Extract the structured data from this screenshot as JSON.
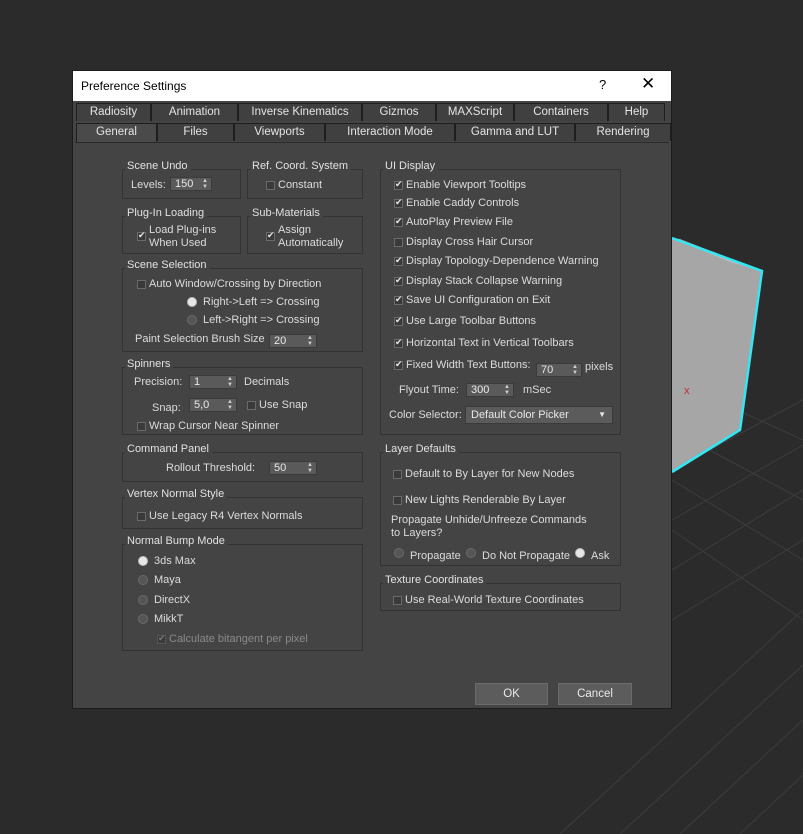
{
  "window": {
    "title": "Preference Settings",
    "help_label": "?",
    "close_label": "✕"
  },
  "tabs_row1": [
    "Radiosity",
    "Animation",
    "Inverse Kinematics",
    "Gizmos",
    "MAXScript",
    "Containers",
    "Help"
  ],
  "tabs_row2": [
    "General",
    "Files",
    "Viewports",
    "Interaction Mode",
    "Gamma and LUT",
    "Rendering"
  ],
  "active_tab": "General",
  "scene_undo": {
    "title": "Scene Undo",
    "levels_label": "Levels:",
    "levels_value": "150"
  },
  "ref_coord": {
    "title": "Ref. Coord. System",
    "constant_label": "Constant",
    "constant_checked": false
  },
  "plugin_loading": {
    "title": "Plug-In Loading",
    "load_label_1": "Load Plug-ins",
    "load_label_2": "When Used",
    "load_checked": true
  },
  "sub_materials": {
    "title": "Sub-Materials",
    "assign_label_1": "Assign",
    "assign_label_2": "Automatically",
    "assign_checked": true
  },
  "scene_selection": {
    "title": "Scene Selection",
    "auto_window_label": "Auto Window/Crossing by Direction",
    "auto_window_checked": false,
    "rl_label": "Right->Left => Crossing",
    "lr_label": "Left->Right => Crossing",
    "brush_label": "Paint Selection Brush Size",
    "brush_value": "20"
  },
  "spinners": {
    "title": "Spinners",
    "precision_label": "Precision:",
    "precision_value": "1",
    "decimals_label": "Decimals",
    "snap_label": "Snap:",
    "snap_value": "5,0",
    "use_snap_label": "Use Snap",
    "wrap_label": "Wrap Cursor Near Spinner"
  },
  "command_panel": {
    "title": "Command Panel",
    "rollout_label": "Rollout Threshold:",
    "rollout_value": "50"
  },
  "vertex_normal": {
    "title": "Vertex Normal Style",
    "legacy_label": "Use Legacy R4 Vertex Normals"
  },
  "normal_bump": {
    "title": "Normal Bump Mode",
    "options": [
      "3ds Max",
      "Maya",
      "DirectX",
      "MikkT"
    ],
    "selected": "3ds Max",
    "calc_label": "Calculate bitangent per pixel"
  },
  "ui_display": {
    "title": "UI Display",
    "items": [
      {
        "label": "Enable Viewport Tooltips",
        "checked": true
      },
      {
        "label": "Enable Caddy Controls",
        "checked": true
      },
      {
        "label": "AutoPlay Preview File",
        "checked": true
      },
      {
        "label": "Display Cross Hair Cursor",
        "checked": false
      },
      {
        "label": "Display Topology-Dependence Warning",
        "checked": true
      },
      {
        "label": "Display Stack Collapse Warning",
        "checked": true
      },
      {
        "label": "Save UI Configuration on Exit",
        "checked": true
      },
      {
        "label": "Use Large Toolbar Buttons",
        "checked": true
      },
      {
        "label": "Horizontal Text in Vertical Toolbars",
        "checked": true
      }
    ],
    "fixed_width_label": "Fixed Width Text Buttons:",
    "fixed_width_value": "70",
    "pixels_label": "pixels",
    "flyout_label": "Flyout Time:",
    "flyout_value": "300",
    "msec_label": "mSec",
    "color_selector_label": "Color Selector:",
    "color_selector_value": "Default Color Picker"
  },
  "layer_defaults": {
    "title": "Layer Defaults",
    "default_bylayer_label": "Default to By Layer for New Nodes",
    "new_lights_label": "New Lights Renderable By Layer",
    "propagate_label_1": "Propagate Unhide/Unfreeze Commands",
    "propagate_label_2": "to Layers?",
    "options": [
      "Propagate",
      "Do Not Propagate",
      "Ask"
    ],
    "selected": "Ask"
  },
  "texture_coords": {
    "title": "Texture Coordinates",
    "realworld_label": "Use Real-World Texture Coordinates"
  },
  "buttons": {
    "ok": "OK",
    "cancel": "Cancel"
  },
  "colors": {
    "dialog_bg": "#444444",
    "viewport_bg": "#2b2b2b",
    "selection_cyan": "#33e6f2",
    "title_bg": "#ffffff"
  }
}
